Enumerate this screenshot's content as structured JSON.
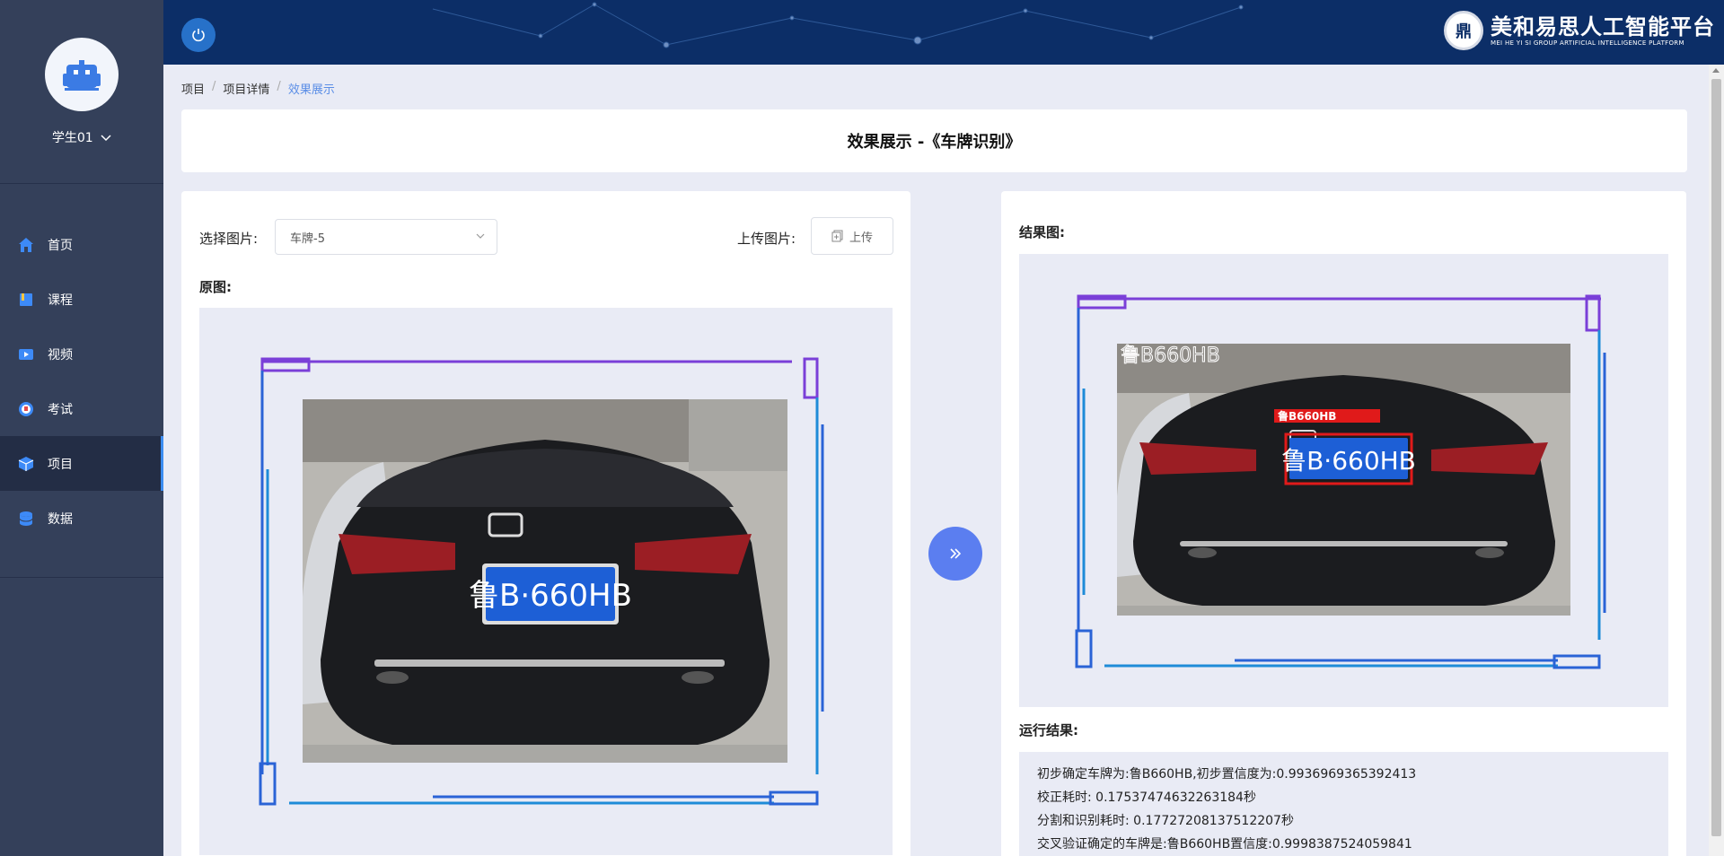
{
  "sidebar": {
    "user": {
      "name": "学生01"
    },
    "items": [
      {
        "label": "首页",
        "icon": "home-icon"
      },
      {
        "label": "课程",
        "icon": "book-icon"
      },
      {
        "label": "视频",
        "icon": "video-icon"
      },
      {
        "label": "考试",
        "icon": "exam-icon"
      },
      {
        "label": "项目",
        "icon": "project-cube-icon",
        "active": true
      },
      {
        "label": "数据",
        "icon": "database-icon"
      }
    ]
  },
  "header": {
    "logo_cn": "美和易思人工智能平台",
    "logo_en": "MEI HE YI SI GROUP ARTIFICIAL INTELLIGENCE PLATFORM",
    "logo_seal": "鼎"
  },
  "breadcrumb": [
    "项目",
    "项目详情",
    "效果展示"
  ],
  "page_title": "效果展示 -《车牌识别》",
  "left": {
    "select_label": "选择图片:",
    "select_value": "车牌-5",
    "upload_label": "上传图片:",
    "upload_button": "上传",
    "original_label": "原图:",
    "plate_text": "鲁B·660HB"
  },
  "right": {
    "result_image_label": "结果图:",
    "overlay_text": "鲁B660HB",
    "box_label": "鲁B660HB",
    "plate_text": "鲁B·660HB",
    "run_result_label": "运行结果:",
    "results": [
      "初步确定车牌为:鲁B660HB,初步置信度为:0.9936969365392413",
      "校正耗时: 0.17537474632263184秒",
      "分割和识别耗时: 0.17727208137512207秒",
      "交叉验证确定的车牌是:鲁B660HB置信度:0.9998387524059841"
    ]
  },
  "colors": {
    "sidebar": "#34405a",
    "header": "#0c2e67",
    "accent": "#5b7ef0",
    "plate_blue": "#1d5fd6",
    "detect_red": "#e01a1a"
  }
}
